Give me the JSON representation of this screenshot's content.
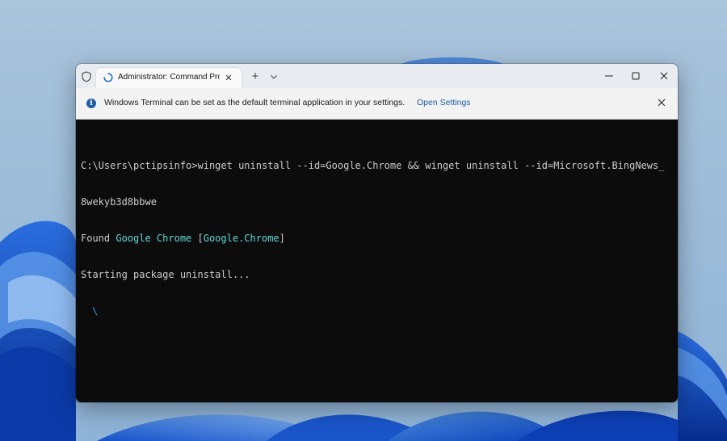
{
  "desktop": {
    "wallpaper_name": "Windows 11 Bloom"
  },
  "titlebar": {
    "icons": {
      "shield": "shield-icon",
      "spinner": "loading-spinner-icon",
      "close_tab": "close-icon",
      "new_tab": "plus-icon",
      "dropdown": "chevron-down-icon",
      "minimize": "minimize-icon",
      "maximize": "maximize-icon",
      "close_window": "close-icon"
    },
    "tab_title": "Administrator: Command Prompt",
    "tab_close_glyph": "✕",
    "new_tab_glyph": "+"
  },
  "infobar": {
    "info_glyph": "i",
    "message": "Windows Terminal can be set as the default terminal application in your settings.",
    "link_label": "Open Settings"
  },
  "console": {
    "line1": "C:\\Users\\pctipsinfo>winget uninstall --id=Google.Chrome && winget uninstall --id=Microsoft.BingNews_",
    "line2": "8wekyb3d8bbwe",
    "line3_prefix": "Found ",
    "line3_name": "Google Chrome",
    "line3_space": " [",
    "line3_id": "Google.Chrome",
    "line3_suffix": "]",
    "line4": "Starting package uninstall...",
    "spinner_char": "\\"
  },
  "colors": {
    "terminal_bg": "#0c0c0c",
    "terminal_fg": "#cccccc",
    "highlight_name": "#3a96dd",
    "highlight_id": "#61d6d6",
    "link": "#1d5aa5"
  }
}
